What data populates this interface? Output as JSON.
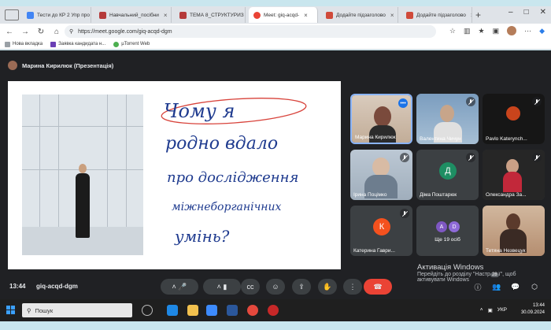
{
  "browser": {
    "tabs": [
      {
        "label": "Тести до КР 2 Упр про",
        "color": "#4285f4"
      },
      {
        "label": "Навчальний_посібни",
        "color": "#b53a3a"
      },
      {
        "label": "ТЕМА 8_СТРУКТУРИЗ",
        "color": "#b53a3a"
      },
      {
        "label": "Meet: giq-acqd-",
        "color": "#ea4335",
        "active": true
      },
      {
        "label": "Додайте підзаголово",
        "color": "#d04a3a"
      },
      {
        "label": "Додайте підзаголово",
        "color": "#d04a3a"
      }
    ],
    "url": "https://meet.google.com/giq-acqd-dgm",
    "bookmarks": [
      "Нова вкладка",
      "Заявка кандидата н...",
      "µTorrent Web"
    ]
  },
  "meet": {
    "presenter_label": "Марина Кирилюк (Презентація)",
    "slide_handwriting": [
      "Чому я",
      "родно вдало",
      "про дослідження",
      "міжнеборганічних",
      "умінь?"
    ],
    "participants": [
      {
        "name": "Марина Кирилюк",
        "type": "video",
        "bg": "#c9b6a3"
      },
      {
        "name": "Валентина Чичун",
        "type": "video",
        "bg": "#88a9c4"
      },
      {
        "name": "Pavlo Katerynch...",
        "type": "video",
        "bg": "#1c1c1c"
      },
      {
        "name": "Ірина Поцімко",
        "type": "video",
        "bg": "#a8b7c6"
      },
      {
        "name": "Діма Поштарюк",
        "type": "avatar",
        "initial": "Д",
        "color": "#1e8e63"
      },
      {
        "name": "Олександра За...",
        "type": "video",
        "bg": "#2d2d2d"
      },
      {
        "name": "Катерина Гаври...",
        "type": "avatar",
        "initial": "К",
        "color": "#f4511e"
      },
      {
        "name": "Ще 19 осіб",
        "type": "group",
        "initials": [
          "A",
          "D"
        ],
        "colors": [
          "#7e57c2",
          "#8e6ad8"
        ]
      },
      {
        "name": "Тетяна Незвецук",
        "type": "video",
        "bg": "#c4a488"
      }
    ],
    "time": "13:44",
    "meeting_code": "giq-acqd-dgm",
    "activation": {
      "title": "Активація Windows",
      "text": "Перейдіть до розділу \"Настр",
      "text2": "активувати Windows"
    },
    "activation_suffix": "ї\", щоб",
    "chat_badge": "28"
  },
  "taskbar": {
    "search_placeholder": "Пошук",
    "lang": "УКР",
    "clock_time": "13:44",
    "clock_date": "30.09.2024"
  }
}
